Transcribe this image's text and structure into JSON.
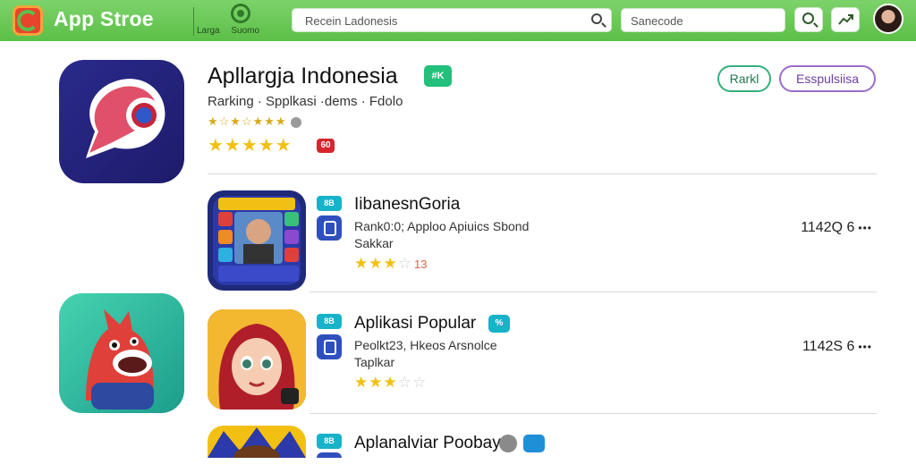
{
  "header": {
    "brand": "App Stroe",
    "region_line1": "Larga",
    "region_line2": "Suomo",
    "search_placeholder": "Recein Ladonesis",
    "search2_placeholder": "Sanecode"
  },
  "featured": {
    "title": "Apllargja Indonesia",
    "badge": "#K",
    "subtitle": "Rarking · Spplkasi ·dems · Fdolo",
    "small_stars": "★☆★☆★★★",
    "stars": "★★★★★",
    "rating_badge": "60",
    "rank_button": "Rarkl",
    "esp_button": "Esspulsiisa"
  },
  "list": [
    {
      "badge": "8B",
      "title": "IibanesnGoria",
      "line1": "Rank0:0; Apploo Apiuics Sbond",
      "line2": "Sakkar",
      "stars_filled": "★★★",
      "stars_empty": "☆",
      "stars_num": "13",
      "count": "1142Q 6",
      "dots": "•••"
    },
    {
      "badge": "8B",
      "title": "Aplikasi Popular",
      "title_badge": "%",
      "line1": "Peolkt23, Hkeos Arsnolce",
      "line2": "Taplkar",
      "stars_filled": "★★★",
      "stars_empty": "☆☆",
      "stars_num": "",
      "count": "1142S 6",
      "dots": "•••"
    },
    {
      "badge": "8B",
      "title": "Aplanalviar Poobay",
      "line1": "",
      "line2": "",
      "stars_filled": "",
      "stars_empty": "",
      "stars_num": "",
      "count": "",
      "dots": ""
    }
  ],
  "colors": {
    "topbar": "#5cbf48",
    "accent_green": "#22c07a",
    "accent_purple": "#9b6cc9",
    "star": "#f2c012"
  }
}
